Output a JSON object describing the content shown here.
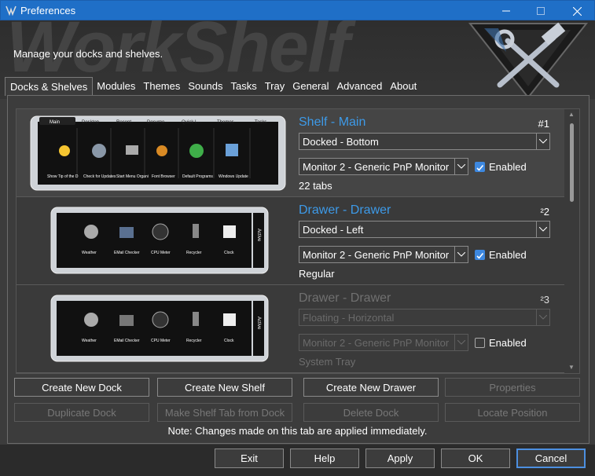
{
  "window": {
    "title": "Preferences"
  },
  "header": {
    "subtitle": "Manage your docks and shelves.",
    "watermark": "WorkShelf"
  },
  "tabs": [
    "Docks & Shelves",
    "Modules",
    "Themes",
    "Sounds",
    "Tasks",
    "Tray",
    "General",
    "Advanced",
    "About"
  ],
  "rows": [
    {
      "title": "Shelf - Main",
      "number": "#1",
      "dock_position": "Docked - Bottom",
      "monitor": "Monitor 2 - Generic PnP Monitor",
      "enabled_label": "Enabled",
      "enabled": true,
      "subtitle": "22 tabs",
      "preview_tabs": [
        "Main",
        "Desktop",
        "Recent",
        "Docume...",
        "Quick L...",
        "Themes",
        "Tasks"
      ],
      "preview_items": [
        "Show Tip of the D",
        "Check for Updates",
        "Start Menu Organi",
        "Font Browser",
        "Default Programs",
        "Windows Update"
      ]
    },
    {
      "title": "Drawer - Drawer",
      "number": "²2",
      "dock_position": "Docked - Left",
      "monitor": "Monitor 2 - Generic PnP Monitor",
      "enabled_label": "Enabled",
      "enabled": true,
      "subtitle": "Regular",
      "preview_items": [
        "Weather",
        "EMail Checker",
        "CPU Meter",
        "Recycler",
        "Clock"
      ],
      "preview_side": "Active"
    },
    {
      "title": "Drawer - Drawer",
      "number": "²3",
      "dock_position": "Floating - Horizontal",
      "monitor": "Monitor 2 - Generic PnP Monitor",
      "enabled_label": "Enabled",
      "enabled": false,
      "subtitle": "System Tray",
      "preview_items": [
        "Weather",
        "EMail Checker",
        "CPU Meter",
        "Recycler",
        "Clock"
      ],
      "preview_side": "Active"
    }
  ],
  "actions": {
    "create_dock": "Create New Dock",
    "create_shelf": "Create New Shelf",
    "create_drawer": "Create New Drawer",
    "properties": "Properties",
    "duplicate_dock": "Duplicate Dock",
    "make_shelf_tab": "Make Shelf Tab from Dock",
    "delete_dock": "Delete Dock",
    "locate_position": "Locate Position"
  },
  "note": "Note: Changes made on this tab are applied immediately.",
  "footer": {
    "exit": "Exit",
    "help": "Help",
    "apply": "Apply",
    "ok": "OK",
    "cancel": "Cancel"
  },
  "colors": {
    "titlebar": "#1f6fc7",
    "accent_title": "#3d9ae8",
    "background": "#3c3c3c",
    "checkbox": "#3d88e0"
  }
}
